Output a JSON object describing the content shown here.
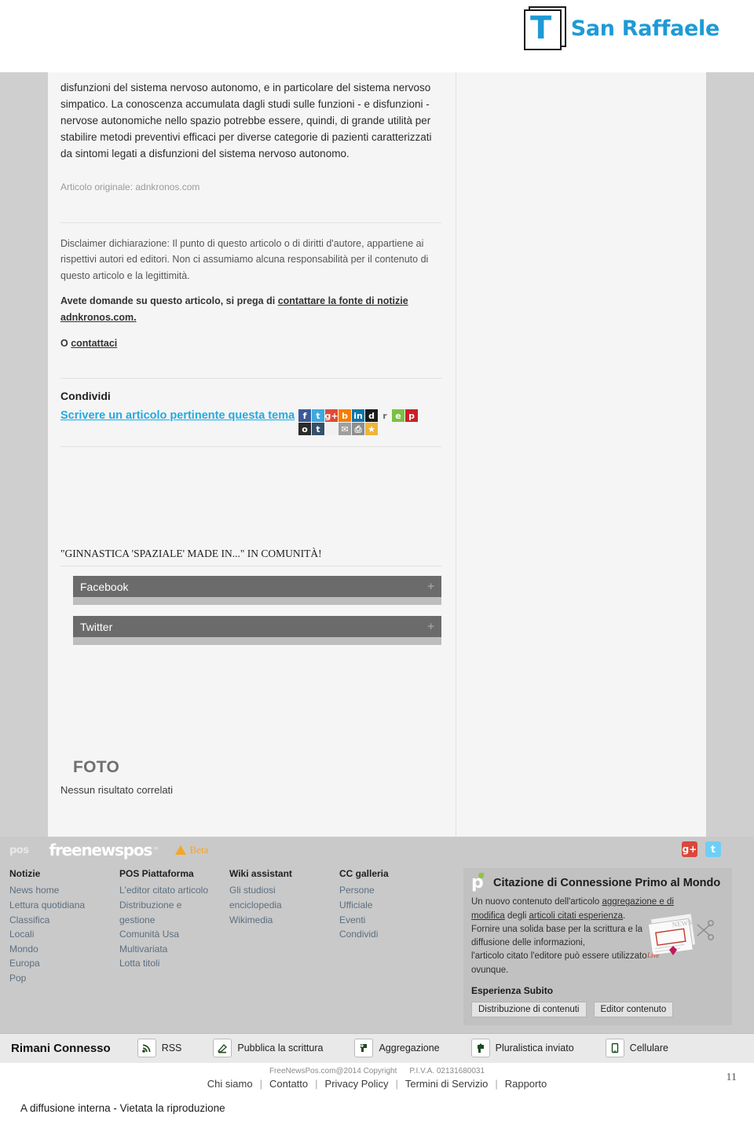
{
  "header": {
    "logo_letter": "T",
    "brand_name": "San Raffaele",
    "logo_icon": "framed-t-logo"
  },
  "article": {
    "body": "disfunzioni del sistema nervoso autonomo, e in particolare del sistema nervoso simpatico. La conoscenza accumulata dagli studi sulle funzioni - e disfunzioni - nervose autonomiche nello spazio potrebbe essere, quindi, di grande utilità per stabilire metodi preventivi efficaci per diverse categorie di pazienti caratterizzati da sintomi legati a disfunzioni del sistema nervoso autonomo.",
    "source_label": "Articolo originale: adnkronos.com"
  },
  "disclaimer": {
    "paragraph": "Disclaimer dichiarazione: Il punto di questo articolo o di diritti d'autore, appartiene ai rispettivi autori ed editori. Non ci assumiamo alcuna responsabilità per il contenuto di questo articolo e la legittimità.",
    "questions_prefix": "Avete domande su questo articolo, si prega di ",
    "questions_link": "contattare la fonte di notizie adnkronos.com.",
    "contact_prefix": "O ",
    "contact_link": "contattaci"
  },
  "share": {
    "title": "Condividi",
    "link_text": "Scrivere un articolo pertinente questa tema",
    "icons": [
      {
        "name": "facebook-icon",
        "glyph": "f",
        "bg": "#3b5998",
        "fg": "#ffffff"
      },
      {
        "name": "twitter-icon",
        "glyph": "t",
        "bg": "#3aa9e0",
        "fg": "#ffffff"
      },
      {
        "name": "google-plus-icon",
        "glyph": "g+",
        "bg": "#dd4b39",
        "fg": "#ffffff"
      },
      {
        "name": "blogger-icon",
        "glyph": "b",
        "bg": "#f57d00",
        "fg": "#ffffff"
      },
      {
        "name": "linkedin-icon",
        "glyph": "in",
        "bg": "#0e76a8",
        "fg": "#ffffff"
      },
      {
        "name": "digg-icon",
        "glyph": "d",
        "bg": "#1b1b1b",
        "fg": "#ffffff"
      },
      {
        "name": "reddit-icon",
        "glyph": "r",
        "bg": "#f5f5f5",
        "fg": "#6b6b6b"
      },
      {
        "name": "evernote-icon",
        "glyph": "e",
        "bg": "#7ac142",
        "fg": "#ffffff"
      },
      {
        "name": "pinterest-icon",
        "glyph": "p",
        "bg": "#cb2027",
        "fg": "#ffffff"
      },
      {
        "name": "instapaper-icon",
        "glyph": "o",
        "bg": "#2b2b2b",
        "fg": "#ffffff"
      },
      {
        "name": "tumblr-icon",
        "glyph": "t",
        "bg": "#35506b",
        "fg": "#ffffff"
      },
      {
        "name": "delicious-icon",
        "glyph": "",
        "bg": "#f1f1f1",
        "fg": "#222222"
      },
      {
        "name": "email-icon",
        "glyph": "✉",
        "bg": "#9f9f9f",
        "fg": "#ffffff"
      },
      {
        "name": "printer-icon",
        "glyph": "⎙",
        "bg": "#8e8e8e",
        "fg": "#ffffff"
      },
      {
        "name": "favorite-icon",
        "glyph": "★",
        "bg": "#f0b437",
        "fg": "#ffffff"
      },
      {
        "name": "spacer-1",
        "glyph": "",
        "bg": "transparent",
        "fg": "#ffffff"
      },
      {
        "name": "spacer-2",
        "glyph": "",
        "bg": "transparent",
        "fg": "#ffffff"
      },
      {
        "name": "spacer-3",
        "glyph": "",
        "bg": "transparent",
        "fg": "#ffffff"
      }
    ]
  },
  "community": {
    "title": "\"GINNASTICA 'SPAZIALE' MADE IN...\" IN COMUNITÀ!",
    "widgets": [
      {
        "name": "facebook-widget",
        "label": "Facebook",
        "toggle": "+"
      },
      {
        "name": "twitter-widget",
        "label": "Twitter",
        "toggle": "+"
      }
    ]
  },
  "foto": {
    "title": "FOTO",
    "empty_text": "Nessun risultato correlati"
  },
  "footer": {
    "brand_mini": "pos",
    "wordmark": "freenewspos",
    "trademark": "∞",
    "beta_label": "Beta",
    "social": [
      {
        "name": "google-plus-icon",
        "glyph": "g+",
        "bg": "#d9483b"
      },
      {
        "name": "twitter-icon",
        "glyph": "t",
        "bg": "#6ecff6"
      }
    ],
    "columns": [
      {
        "name": "notizie",
        "heading": "Notizie",
        "links": [
          "News home",
          "Lettura quotidiana",
          "Classifica",
          "Locali",
          "Mondo",
          "Europa",
          "Pop"
        ]
      },
      {
        "name": "pos-piattaforma",
        "heading": "POS Piattaforma",
        "links": [
          "L'editor citato articolo",
          "Distribuzione e",
          "gestione",
          "Comunità Usa",
          "Multivariata",
          "Lotta titoli"
        ]
      },
      {
        "name": "wiki-assistant",
        "heading": "Wiki assistant",
        "links": [
          "Gli studiosi",
          "enciclopedia",
          "Wikimedia"
        ]
      },
      {
        "name": "cc-galleria",
        "heading": "CC galleria",
        "links": [
          "Persone",
          "Ufficiale",
          "Eventi",
          "Condividi"
        ]
      }
    ],
    "promo": {
      "logo_letter": "p",
      "title": "Citazione di Connessione Primo al Mondo",
      "line1_a": "Un nuovo contenuto dell'articolo ",
      "line1_link": "aggregazione e di modifica",
      "line1_b": " degli ",
      "line2_link": "articoli citati esperienza",
      "line2_b": ".",
      "line3": "Fornire una solida base per la scrittura e la",
      "line4": "diffusione delle informazioni,",
      "line5": "l'articolo citato l'editore può essere utilizzato",
      "line6": "ovunque.",
      "subtitle": "Esperienza Subito",
      "buttons": [
        "Distribuzione di contenuti",
        "Editor contenuto"
      ]
    },
    "connect": {
      "title": "Rimani Connesso",
      "items": [
        {
          "name": "rss-item",
          "icon": "rss-icon",
          "label": "RSS"
        },
        {
          "name": "publish-item",
          "icon": "pencil-icon",
          "label": "Pubblica la scrittura"
        },
        {
          "name": "aggregate-item",
          "icon": "aggregate-icon",
          "label": "Aggregazione"
        },
        {
          "name": "pluralistic-item",
          "icon": "send-icon",
          "label": "Pluralistica inviato"
        },
        {
          "name": "mobile-item",
          "icon": "phone-icon",
          "label": "Cellulare"
        }
      ]
    },
    "copyright": "FreeNewsPos.com@2014 Copyright",
    "vat": "P.I.V.A. 02131680031",
    "bottom_links": [
      "Chi siamo",
      "Contatto",
      "Privacy Policy",
      "Termini di Servizio",
      "Rapporto"
    ]
  },
  "document": {
    "page_number": "11",
    "footnote": "A diffusione interna - Vietata la riproduzione"
  }
}
